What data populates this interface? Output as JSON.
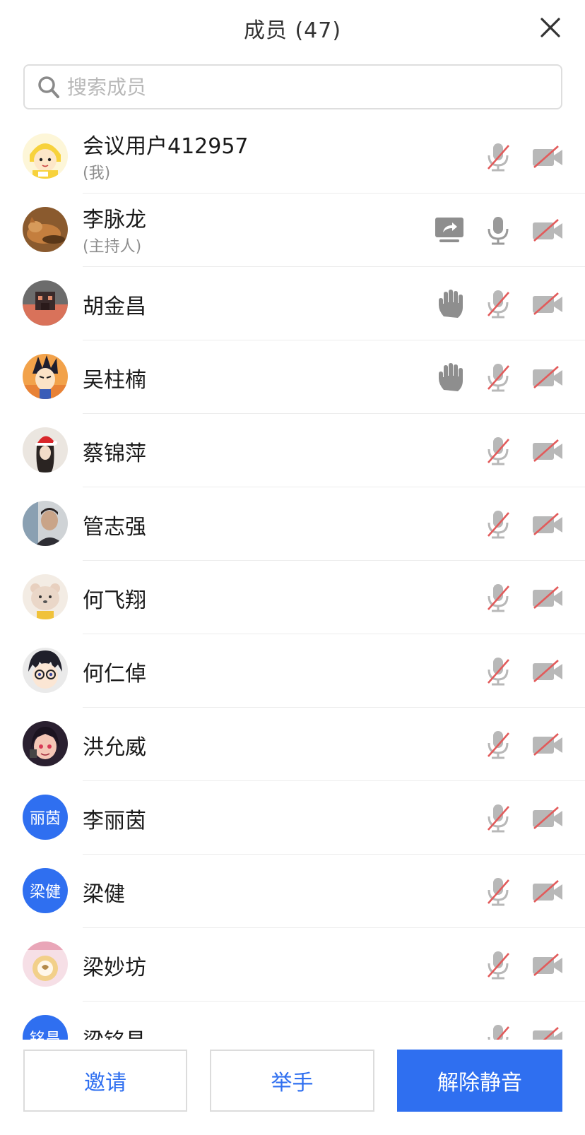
{
  "header": {
    "title": "成员 (47)"
  },
  "search": {
    "placeholder": "搜索成员"
  },
  "members": [
    {
      "name": "会议用户412957",
      "sub": "(我)",
      "mic": "muted",
      "cam": "off",
      "avatar": "cartoon-baby"
    },
    {
      "name": "李脉龙",
      "sub": "(主持人)",
      "sharing": true,
      "mic": "on",
      "cam": "off",
      "avatar": "photo-cat"
    },
    {
      "name": "胡金昌",
      "hand": true,
      "mic": "muted",
      "cam": "off",
      "avatar": "photo-building"
    },
    {
      "name": "吴柱楠",
      "hand": true,
      "mic": "muted",
      "cam": "off",
      "avatar": "anime-vegeta"
    },
    {
      "name": "蔡锦萍",
      "mic": "muted",
      "cam": "off",
      "avatar": "drawing-santa-hat"
    },
    {
      "name": "管志强",
      "mic": "muted",
      "cam": "off",
      "avatar": "photo-man"
    },
    {
      "name": "何飞翔",
      "mic": "muted",
      "cam": "off",
      "avatar": "drawing-bear"
    },
    {
      "name": "何仁倬",
      "mic": "muted",
      "cam": "off",
      "avatar": "anime-conan"
    },
    {
      "name": "洪允威",
      "mic": "muted",
      "cam": "off",
      "avatar": "anime-girl"
    },
    {
      "name": "李丽茵",
      "mic": "muted",
      "cam": "off",
      "avatar_text": "丽茵"
    },
    {
      "name": "梁健",
      "mic": "muted",
      "cam": "off",
      "avatar_text": "梁健"
    },
    {
      "name": "梁妙坊",
      "mic": "muted",
      "cam": "off",
      "avatar": "drawing-pink"
    },
    {
      "name": "梁铭昌",
      "mic": "muted",
      "cam": "off",
      "avatar_text": "铭昌"
    }
  ],
  "footer": {
    "invite_label": "邀请",
    "raise_hand_label": "举手",
    "unmute_label": "解除静音"
  },
  "colors": {
    "accent": "#2f6ff0",
    "muted_slash": "#e25b5b",
    "icon_gray": "#9a9a9a"
  }
}
